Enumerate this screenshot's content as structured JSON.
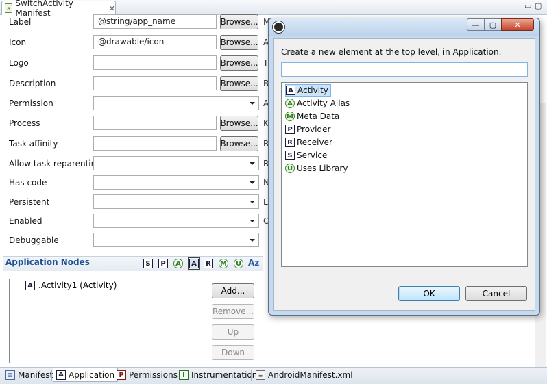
{
  "editor": {
    "tab_title": "SwitchActivity Manifest",
    "file_icon": "a",
    "close_glyph": "✕",
    "minimize_glyph": "▭",
    "maximize_glyph": "▢"
  },
  "form": {
    "label": {
      "label": "Label",
      "value": "@string/app_name",
      "browse": "Browse..."
    },
    "icon": {
      "label": "Icon",
      "value": "@drawable/icon",
      "browse": "Browse..."
    },
    "logo": {
      "label": "Logo",
      "value": "",
      "browse": "Browse..."
    },
    "description": {
      "label": "Description",
      "value": "",
      "browse": "Browse..."
    },
    "permission": {
      "label": "Permission",
      "value": ""
    },
    "process": {
      "label": "Process",
      "value": "",
      "browse": "Browse..."
    },
    "task_affinity": {
      "label": "Task affinity",
      "value": "",
      "browse": "Browse..."
    },
    "allow_task_reparenting": {
      "label": "Allow task reparenting",
      "value": ""
    },
    "has_code": {
      "label": "Has code",
      "value": ""
    },
    "persistent": {
      "label": "Persistent",
      "value": ""
    },
    "enabled": {
      "label": "Enabled",
      "value": ""
    },
    "debuggable": {
      "label": "Debuggable",
      "value": ""
    }
  },
  "right_column_letters": [
    "M",
    "A",
    "T",
    "B",
    "A",
    "K",
    "R",
    "R",
    "N",
    "L",
    "C"
  ],
  "nodes": {
    "title": "Application Nodes",
    "filters": [
      "S",
      "P",
      "A",
      "A",
      "R",
      "M",
      "U"
    ],
    "sort_label": "Az",
    "items": [
      {
        "glyph": "A",
        "label": ".Activity1 (Activity)"
      }
    ],
    "buttons": {
      "add": "Add...",
      "remove": "Remove...",
      "up": "Up",
      "down": "Down"
    }
  },
  "bottom_tabs": [
    {
      "label": "Manifest"
    },
    {
      "label": "Application",
      "glyph": "A"
    },
    {
      "label": "Permissions",
      "glyph": "P"
    },
    {
      "label": "Instrumentation",
      "glyph": "I"
    },
    {
      "label": "AndroidManifest.xml"
    }
  ],
  "dialog": {
    "prompt": "Create a new element at the top level, in Application.",
    "filter_value": "",
    "items": [
      {
        "glyph": "A",
        "label": "Activity",
        "selected": true
      },
      {
        "glyph": "A",
        "label": "Activity Alias"
      },
      {
        "glyph": "M",
        "label": "Meta Data"
      },
      {
        "glyph": "P",
        "label": "Provider"
      },
      {
        "glyph": "R",
        "label": "Receiver"
      },
      {
        "glyph": "S",
        "label": "Service"
      },
      {
        "glyph": "U",
        "label": "Uses Library"
      }
    ],
    "ok_label": "OK",
    "cancel_label": "Cancel",
    "minimize_glyph": "—",
    "maximize_glyph": "▢",
    "close_glyph": "✕"
  },
  "colors": {
    "section_title": "#1d4f91",
    "selection": "#cde3f8",
    "dialog_frame": "#c5d9ef"
  }
}
